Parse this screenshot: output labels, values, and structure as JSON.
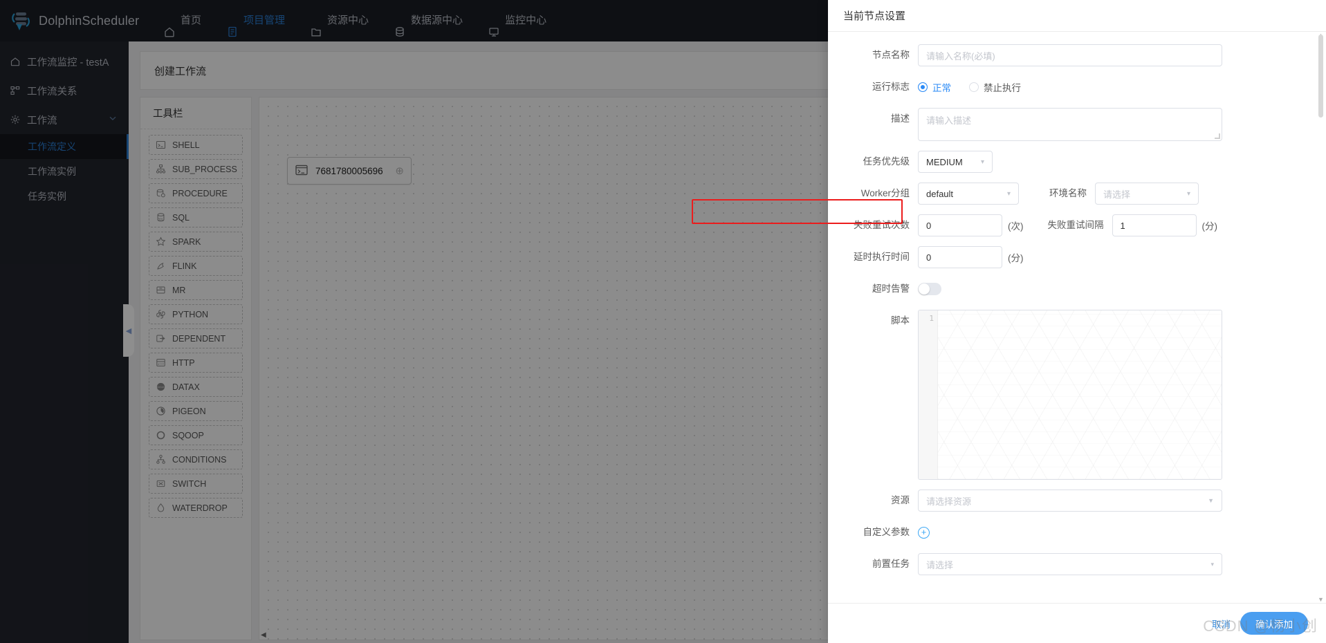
{
  "topnav": {
    "brand": "DolphinScheduler",
    "items": [
      {
        "label": "首页",
        "icon": "home-icon",
        "active": false
      },
      {
        "label": "项目管理",
        "icon": "project-icon",
        "active": true
      },
      {
        "label": "资源中心",
        "icon": "folder-icon",
        "active": false
      },
      {
        "label": "数据源中心",
        "icon": "database-icon",
        "active": false
      },
      {
        "label": "监控中心",
        "icon": "monitor-icon",
        "active": false
      }
    ]
  },
  "sidebar": {
    "items": [
      {
        "label": "工作流监控 - testA",
        "icon": "home-icon"
      },
      {
        "label": "工作流关系",
        "icon": "relation-icon"
      },
      {
        "label": "工作流",
        "icon": "gear-icon",
        "expandable": true
      }
    ],
    "sub_items": [
      {
        "label": "工作流定义",
        "active": true
      },
      {
        "label": "工作流实例",
        "active": false
      },
      {
        "label": "任务实例",
        "active": false
      }
    ]
  },
  "page": {
    "title": "创建工作流"
  },
  "toolbox": {
    "title": "工具栏",
    "items": [
      {
        "label": "SHELL",
        "icon": "terminal-icon"
      },
      {
        "label": "SUB_PROCESS",
        "icon": "sitemap-icon"
      },
      {
        "label": "PROCEDURE",
        "icon": "procedure-icon"
      },
      {
        "label": "SQL",
        "icon": "sql-icon"
      },
      {
        "label": "SPARK",
        "icon": "spark-icon"
      },
      {
        "label": "FLINK",
        "icon": "flink-icon"
      },
      {
        "label": "MR",
        "icon": "mr-icon"
      },
      {
        "label": "PYTHON",
        "icon": "python-icon"
      },
      {
        "label": "DEPENDENT",
        "icon": "dependent-icon"
      },
      {
        "label": "HTTP",
        "icon": "http-icon"
      },
      {
        "label": "DATAX",
        "icon": "datax-icon"
      },
      {
        "label": "PIGEON",
        "icon": "pigeon-icon"
      },
      {
        "label": "SQOOP",
        "icon": "sqoop-icon"
      },
      {
        "label": "CONDITIONS",
        "icon": "conditions-icon"
      },
      {
        "label": "SWITCH",
        "icon": "switch-icon"
      },
      {
        "label": "WATERDROP",
        "icon": "waterdrop-icon"
      }
    ]
  },
  "canvas": {
    "node": {
      "label": "7681780005696",
      "icon": "terminal-icon"
    }
  },
  "panel": {
    "title": "当前节点设置",
    "node_name": {
      "label": "节点名称",
      "placeholder": "请输入名称(必填)",
      "value": ""
    },
    "run_flag": {
      "label": "运行标志",
      "options": [
        {
          "label": "正常",
          "selected": true
        },
        {
          "label": "禁止执行",
          "selected": false
        }
      ]
    },
    "description": {
      "label": "描述",
      "placeholder": "请输入描述",
      "value": ""
    },
    "priority": {
      "label": "任务优先级",
      "value": "MEDIUM"
    },
    "worker_group": {
      "label": "Worker分组",
      "value": "default"
    },
    "environment": {
      "label": "环境名称",
      "placeholder": "请选择",
      "value": ""
    },
    "retry_times": {
      "label": "失败重试次数",
      "value": "0",
      "unit": "(次)"
    },
    "retry_interval": {
      "label": "失败重试间隔",
      "value": "1",
      "unit": "(分)"
    },
    "delay_time": {
      "label": "延时执行时间",
      "value": "0",
      "unit": "(分)",
      "highlighted": true
    },
    "timeout_alarm": {
      "label": "超时告警",
      "on": false
    },
    "script": {
      "label": "脚本",
      "line_number": "1",
      "value": ""
    },
    "resource": {
      "label": "资源",
      "placeholder": "请选择资源"
    },
    "custom_params": {
      "label": "自定义参数",
      "add_icon": "plus-circle-icon"
    },
    "pre_task": {
      "label": "前置任务",
      "placeholder": "请选择"
    },
    "cancel_label": "取消",
    "confirm_label": "确认添加"
  },
  "watermark": "CSDN @杨小创",
  "colors": {
    "accent": "#2a7fd4",
    "primary_button": "#4a9ef0",
    "highlight": "#ec1c1c",
    "nav_bg": "#1b1e26",
    "sidebar_bg": "#22252d"
  }
}
